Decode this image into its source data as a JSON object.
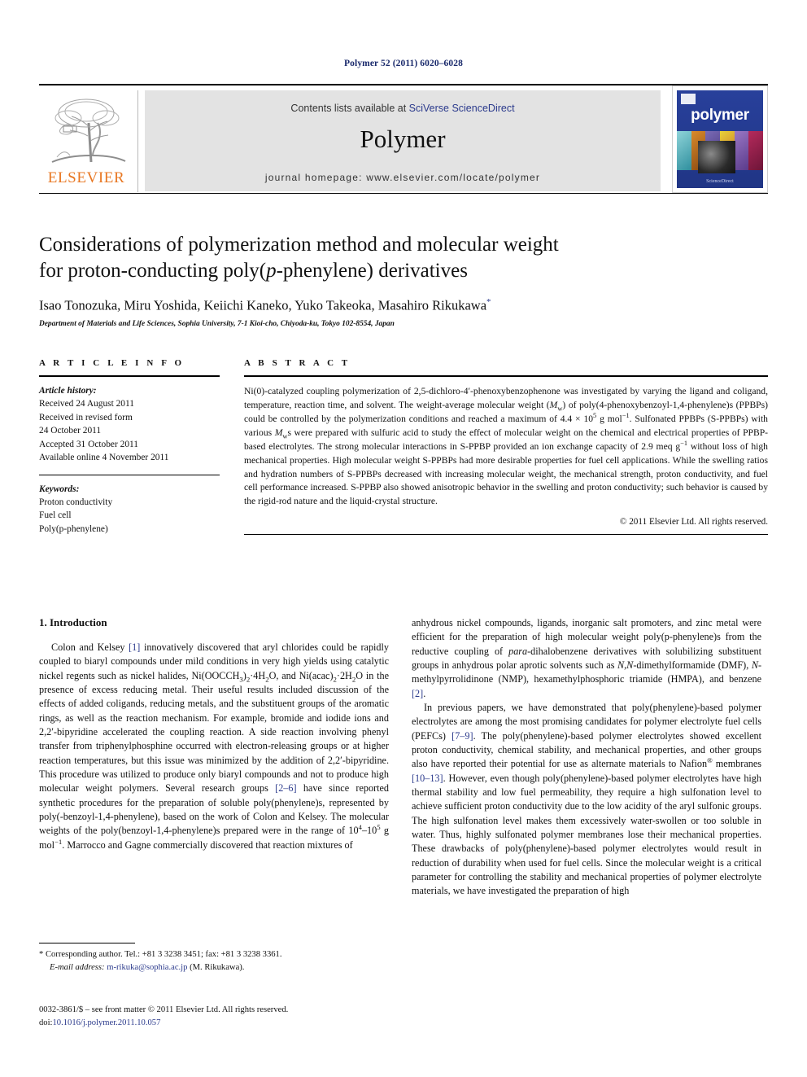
{
  "running_head": "Polymer 52 (2011) 6020–6028",
  "masthead": {
    "contents_prefix": "Contents lists available at ",
    "sciencedirect_link": "SciVerse ScienceDirect",
    "journal_title": "Polymer",
    "homepage": "journal homepage: www.elsevier.com/locate/polymer",
    "publisher_name": "ELSEVIER",
    "cover_word": "polymer",
    "cover_footer": "ScienceDirect"
  },
  "title": {
    "line1": "Considerations of polymerization method and molecular weight",
    "line2_pre": "for proton-conducting poly(",
    "line2_italic": "p",
    "line2_post": "-phenylene) derivatives"
  },
  "authors": {
    "names": "Isao Tonozuka, Miru Yoshida, Keiichi Kaneko, Yuko Takeoka, Masahiro Rikukawa",
    "corresponding_marker": "*",
    "affiliation": "Department of Materials and Life Sciences, Sophia University, 7-1 Kioi-cho, Chiyoda-ku, Tokyo 102-8554, Japan"
  },
  "article_info": {
    "heading": "A R T I C L E    I N F O",
    "history_label": "Article history:",
    "history": [
      "Received 24 August 2011",
      "Received in revised form",
      "24 October 2011",
      "Accepted 31 October 2011",
      "Available online 4 November 2011"
    ],
    "keywords_label": "Keywords:",
    "keywords": [
      "Proton conductivity",
      "Fuel cell",
      "Poly(p-phenylene)"
    ]
  },
  "abstract": {
    "heading": "A B S T R A C T",
    "copyright": "© 2011 Elsevier Ltd. All rights reserved."
  },
  "body": {
    "section1_heading": "1. Introduction",
    "references": {
      "r1": "[1]",
      "r2_6": "[2–6]",
      "r2": "[2]",
      "r7_9": "[7–9]",
      "r10_13": "[10–13]"
    }
  },
  "footnote": {
    "corresponding": "* Corresponding author. Tel.: +81 3 3238 3451; fax: +81 3 3238 3361.",
    "email_label": "E-mail address:",
    "email": "m-rikuka@sophia.ac.jp",
    "email_owner": "(M. Rikukawa).",
    "issn_line": "0032-3861/$ – see front matter © 2011 Elsevier Ltd. All rights reserved.",
    "doi_label": "doi:",
    "doi": "10.1016/j.polymer.2011.10.057"
  },
  "colors": {
    "link_blue": "#2b3a8c",
    "elsevier_orange": "#e87722",
    "cover_blue": "#1f3a93",
    "band_gray": "#e3e3e3"
  }
}
